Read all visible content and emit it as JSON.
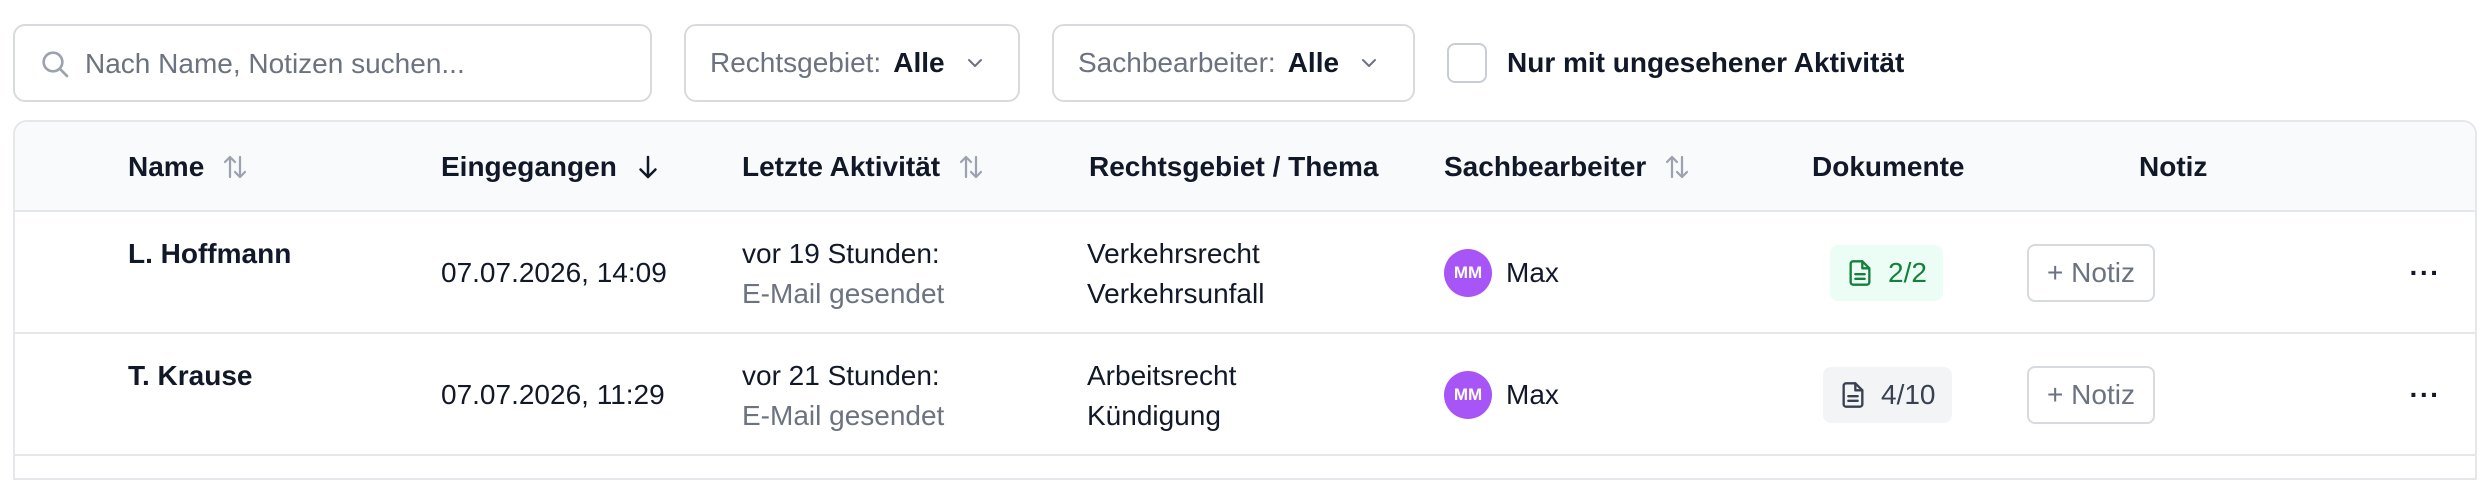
{
  "filters": {
    "search": {
      "placeholder": "Nach Name, Notizen suchen...",
      "value": ""
    },
    "rechtsgebiet": {
      "label": "Rechtsgebiet:",
      "value": "Alle"
    },
    "sachbearbeiter": {
      "label": "Sachbearbeiter:",
      "value": "Alle"
    },
    "unseen_only": {
      "label": "Nur mit ungesehener Aktivität",
      "checked": false
    }
  },
  "table": {
    "columns": {
      "name": "Name",
      "received": "Eingegangen",
      "last_activity": "Letzte Aktivität",
      "law_topic": "Rechtsgebiet / Thema",
      "clerk": "Sachbearbeiter",
      "documents": "Dokumente",
      "note": "Notiz"
    },
    "rows": [
      {
        "name": "L. Hoffmann",
        "received": "07.07.2026, 14:09",
        "activity_time": "vor 19 Stunden:",
        "activity_desc": "E-Mail gesendet",
        "law_area": "Verkehrsrecht",
        "topic": "Verkehrsunfall",
        "clerk_initials": "MM",
        "clerk_name": "Max",
        "documents": "2/2",
        "documents_complete": true,
        "note_label": "+ Notiz",
        "more_label": "···"
      },
      {
        "name": "T. Krause",
        "received": "07.07.2026, 11:29",
        "activity_time": "vor 21 Stunden:",
        "activity_desc": "E-Mail gesendet",
        "law_area": "Arbeitsrecht",
        "topic": "Kündigung",
        "clerk_initials": "MM",
        "clerk_name": "Max",
        "documents": "4/10",
        "documents_complete": false,
        "note_label": "+ Notiz",
        "more_label": "···"
      }
    ]
  },
  "colors": {
    "avatar": "#a855f7",
    "doc_complete_bg": "#ecfdf5",
    "doc_complete_text": "#15803d",
    "doc_incomplete_bg": "#f3f4f6",
    "doc_incomplete_text": "#374151"
  },
  "icons": {
    "search": "search-icon",
    "chevron": "chevron-down-icon",
    "sort": "sort-arrows-icon",
    "sort_desc": "arrow-down-icon",
    "document": "document-icon",
    "more": "more-horizontal-icon"
  }
}
